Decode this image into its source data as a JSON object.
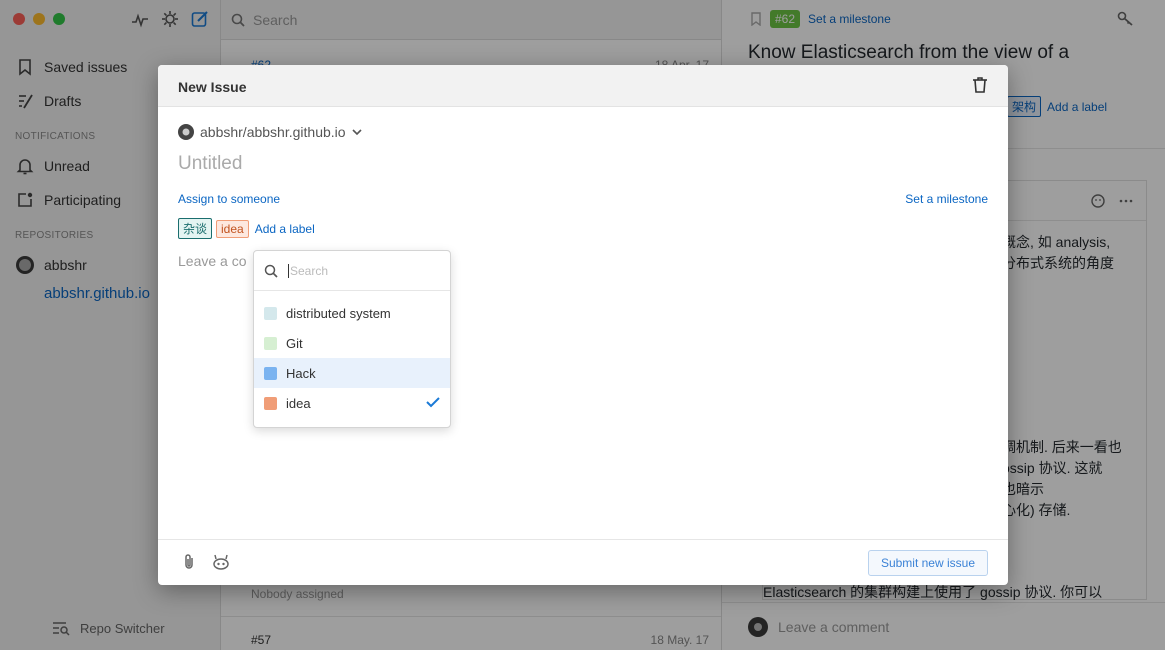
{
  "sidebar": {
    "items": [
      {
        "label": "Saved issues"
      },
      {
        "label": "Drafts"
      }
    ],
    "notifications_heading": "NOTIFICATIONS",
    "notifications": [
      {
        "label": "Unread"
      },
      {
        "label": "Participating"
      }
    ],
    "repositories_heading": "REPOSITORIES",
    "repo_owner": "abbshr",
    "repo_name": "abbshr.github.io",
    "repo_switcher": "Repo Switcher"
  },
  "list": {
    "search_placeholder": "Search",
    "top_issue_number": "#62",
    "top_issue_date": "18 Apr. 17",
    "assignee_text": "Nobody assigned",
    "bottom_issue_number": "#57",
    "bottom_issue_date": "18 May. 17"
  },
  "detail": {
    "issue_badge": "#62",
    "set_milestone": "Set a milestone",
    "title": "Know Elasticsearch from the view of a",
    "label_fragment": "架构",
    "add_label": "Add a label",
    "text_lines": [
      "概念, 如 analysis,",
      "分布式系统的角度",
      "调机制. 后来一看也",
      "ossip 协议. 这就",
      "也暗示",
      "心化) 存储.",
      "Elasticsearch 的集群构建上使用了 gossip 协议. 你可以"
    ],
    "comment_placeholder": "Leave a comment"
  },
  "modal": {
    "title": "New Issue",
    "repo": "abbshr/abbshr.github.io",
    "title_placeholder": "Untitled",
    "assign_label": "Assign to someone",
    "milestone_label": "Set a milestone",
    "labels": [
      {
        "name": "杂谈",
        "color": "#1b6e6e"
      },
      {
        "name": "idea",
        "color": "#f09d77"
      }
    ],
    "add_label": "Add a label",
    "comment_placeholder": "Leave a co",
    "submit_label": "Submit new issue",
    "dropdown": {
      "search_placeholder": "Search",
      "items": [
        {
          "name": "distributed system",
          "color": "#d4e8ec",
          "selected": false
        },
        {
          "name": "Git",
          "color": "#d6efd2",
          "selected": false
        },
        {
          "name": "Hack",
          "color": "#7ab3f0",
          "selected": false,
          "highlighted": true
        },
        {
          "name": "idea",
          "color": "#f09d77",
          "selected": true
        }
      ]
    }
  }
}
